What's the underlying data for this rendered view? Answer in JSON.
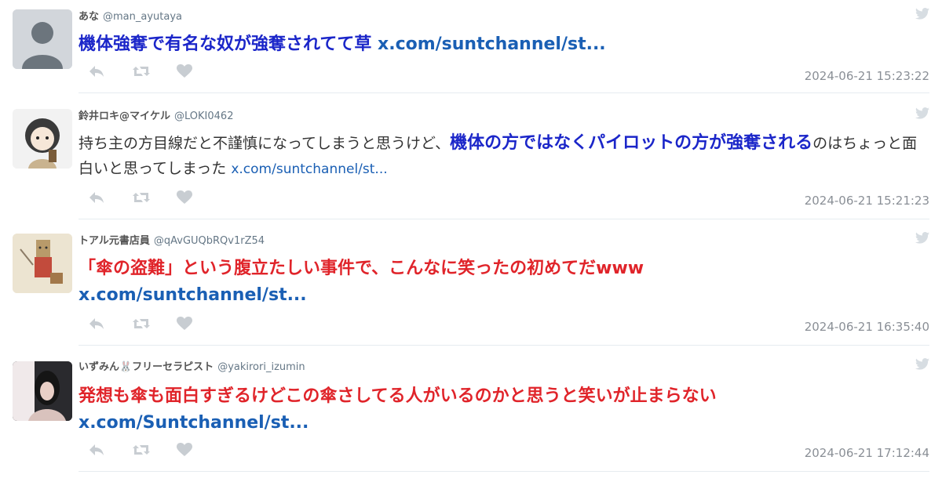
{
  "tweets": [
    {
      "name": "あな",
      "handle": "@man_ayutaya",
      "segments": [
        {
          "text": "機体強奪で有名な奴が強奪されてて草 ",
          "style": "blue"
        },
        {
          "text": "x.com/suntchannel/st...",
          "style": "link"
        }
      ],
      "timestamp": "2024-06-21 15:23:22"
    },
    {
      "name": "鈴井ロキ@マイケル",
      "handle": "@LOKI0462",
      "segments": [
        {
          "text": "持ち主の方目線だと不謹慎になってしまうと思うけど、",
          "style": "plain"
        },
        {
          "text": "機体の方ではなくパイロットの方が強奪される",
          "style": "hl"
        },
        {
          "text": "のはちょっと面白いと思ってしまった ",
          "style": "plain"
        },
        {
          "text": "x.com/suntchannel/st...",
          "style": "link"
        }
      ],
      "timestamp": "2024-06-21 15:21:23"
    },
    {
      "name": "トアル元書店員",
      "handle": "@qAvGUQbRQv1rZ54",
      "segments": [
        {
          "text": "「傘の盗難」という腹立たしい事件で、こんなに笑ったの初めてだwww",
          "style": "red"
        },
        {
          "text": "x.com/suntchannel/st...",
          "style": "link"
        }
      ],
      "timestamp": "2024-06-21 16:35:40"
    },
    {
      "name": "いずみん🐰フリーセラピスト",
      "handle": "@yakirori_izumin",
      "segments": [
        {
          "text": "発想も傘も面白すぎるけどこの傘さしてる人がいるのかと思うと笑いが止まらない",
          "style": "red"
        },
        {
          "text": "x.com/Suntchannel/st...",
          "style": "link"
        }
      ],
      "timestamp": "2024-06-21 17:12:44"
    }
  ],
  "icons": {
    "reply": "reply-icon",
    "retweet": "retweet-icon",
    "like": "heart-icon",
    "twitter": "twitter-bird-icon"
  },
  "colors": {
    "highlight_blue": "#1b26c9",
    "highlight_red": "#e0242a",
    "link": "#1a5fb4",
    "muted": "#8a8f96",
    "icon": "#c8cdd2"
  }
}
